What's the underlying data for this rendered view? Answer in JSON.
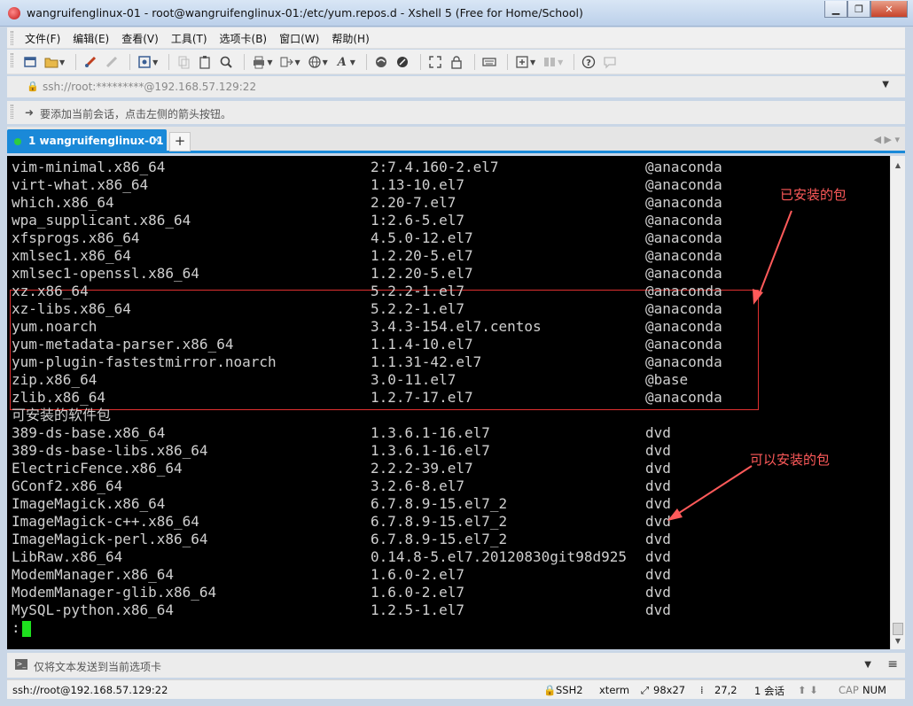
{
  "window": {
    "title": "wangruifenglinux-01 - root@wangruifenglinux-01:/etc/yum.repos.d - Xshell 5 (Free for Home/School)",
    "minimize": "▁",
    "restore": "❐",
    "close": "✕"
  },
  "menu": [
    "文件(F)",
    "编辑(E)",
    "查看(V)",
    "工具(T)",
    "选项卡(B)",
    "窗口(W)",
    "帮助(H)"
  ],
  "address": {
    "lock": "🔒",
    "text": "ssh://root:*********@192.168.57.129:22",
    "dropdown": "▼"
  },
  "session_hint": {
    "icon": "➜",
    "text": "要添加当前会话，点击左侧的箭头按钮。"
  },
  "tab": {
    "label": "1 wangruifenglinux-01",
    "close": "×",
    "add": "+",
    "nav": "◀ ▶  ▾"
  },
  "terminal": {
    "rows": [
      {
        "name": "vim-minimal.x86_64",
        "version": "2:7.4.160-2.el7",
        "repo": "@anaconda"
      },
      {
        "name": "virt-what.x86_64",
        "version": "1.13-10.el7",
        "repo": "@anaconda"
      },
      {
        "name": "which.x86_64",
        "version": "2.20-7.el7",
        "repo": "@anaconda"
      },
      {
        "name": "wpa_supplicant.x86_64",
        "version": "1:2.6-5.el7",
        "repo": "@anaconda"
      },
      {
        "name": "xfsprogs.x86_64",
        "version": "4.5.0-12.el7",
        "repo": "@anaconda"
      },
      {
        "name": "xmlsec1.x86_64",
        "version": "1.2.20-5.el7",
        "repo": "@anaconda"
      },
      {
        "name": "xmlsec1-openssl.x86_64",
        "version": "1.2.20-5.el7",
        "repo": "@anaconda"
      },
      {
        "name": "xz.x86_64",
        "version": "5.2.2-1.el7",
        "repo": "@anaconda"
      },
      {
        "name": "xz-libs.x86_64",
        "version": "5.2.2-1.el7",
        "repo": "@anaconda"
      },
      {
        "name": "yum.noarch",
        "version": "3.4.3-154.el7.centos",
        "repo": "@anaconda"
      },
      {
        "name": "yum-metadata-parser.x86_64",
        "version": "1.1.4-10.el7",
        "repo": "@anaconda"
      },
      {
        "name": "yum-plugin-fastestmirror.noarch",
        "version": "1.1.31-42.el7",
        "repo": "@anaconda"
      },
      {
        "name": "zip.x86_64",
        "version": "3.0-11.el7",
        "repo": "@base"
      },
      {
        "name": "zlib.x86_64",
        "version": "1.2.7-17.el7",
        "repo": "@anaconda"
      },
      {
        "name": "可安装的软件包",
        "version": "",
        "repo": ""
      },
      {
        "name": "389-ds-base.x86_64",
        "version": "1.3.6.1-16.el7",
        "repo": "dvd"
      },
      {
        "name": "389-ds-base-libs.x86_64",
        "version": "1.3.6.1-16.el7",
        "repo": "dvd"
      },
      {
        "name": "ElectricFence.x86_64",
        "version": "2.2.2-39.el7",
        "repo": "dvd"
      },
      {
        "name": "GConf2.x86_64",
        "version": "3.2.6-8.el7",
        "repo": "dvd"
      },
      {
        "name": "ImageMagick.x86_64",
        "version": "6.7.8.9-15.el7_2",
        "repo": "dvd"
      },
      {
        "name": "ImageMagick-c++.x86_64",
        "version": "6.7.8.9-15.el7_2",
        "repo": "dvd"
      },
      {
        "name": "ImageMagick-perl.x86_64",
        "version": "6.7.8.9-15.el7_2",
        "repo": "dvd"
      },
      {
        "name": "LibRaw.x86_64",
        "version": "0.14.8-5.el7.20120830git98d925",
        "repo": "dvd"
      },
      {
        "name": "ModemManager.x86_64",
        "version": "1.6.0-2.el7",
        "repo": "dvd"
      },
      {
        "name": "ModemManager-glib.x86_64",
        "version": "1.6.0-2.el7",
        "repo": "dvd"
      },
      {
        "name": "MySQL-python.x86_64",
        "version": "1.2.5-1.el7",
        "repo": "dvd"
      }
    ],
    "prompt": ":",
    "cursor_color": "#1ee01e",
    "annotation_installed": "已安装的包",
    "annotation_available": "可以安装的包",
    "annotation_color": "#ff5a5a"
  },
  "send_bar": {
    "text": "仅将文本发送到当前选项卡",
    "dropdown": "▼",
    "menu": "≡"
  },
  "status": {
    "connection": "ssh://root@192.168.57.129:22",
    "protocol": "SSH2",
    "term": "xterm",
    "size": "98x27",
    "position": "27,2",
    "sessions": "1 会话",
    "arrows": "⬆ ⬇",
    "cap": "CAP",
    "num": "NUM"
  },
  "colors": {
    "tab_accent": "#1a89d8",
    "terminal_bg": "#000000",
    "terminal_fg": "#cfcfcf",
    "highlight_border": "#e03030"
  }
}
